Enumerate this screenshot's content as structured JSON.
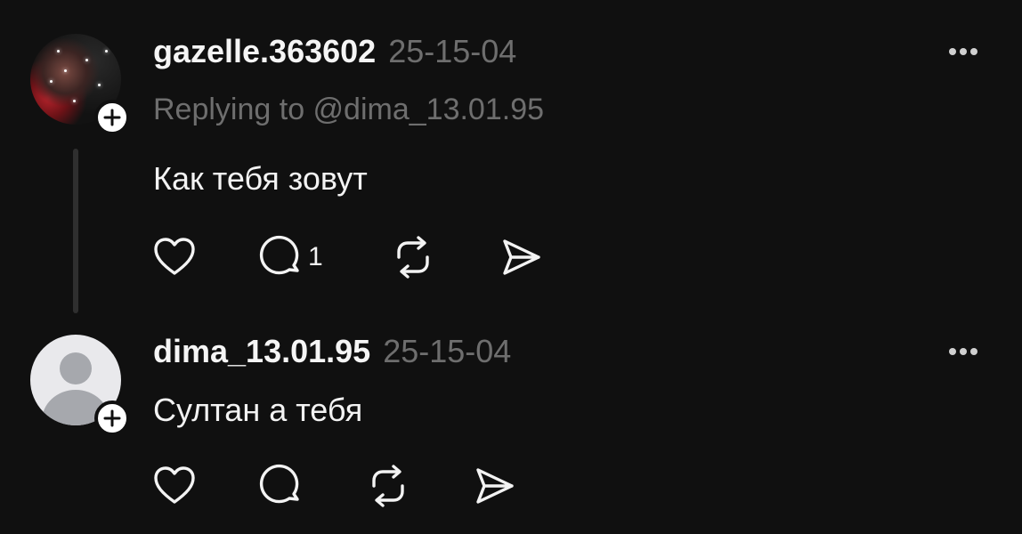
{
  "posts": [
    {
      "username": "gazelle.363602",
      "timestamp": "25-15-04",
      "reply_to": "Replying to @dima_13.01.95",
      "text": "Как тебя зовут",
      "reply_count": "1",
      "avatar_icon": "user-photo",
      "follow_icon": "plus-icon"
    },
    {
      "username": "dima_13.01.95",
      "timestamp": "25-15-04",
      "text": "Султан а тебя",
      "avatar_icon": "default-user-icon",
      "follow_icon": "plus-icon"
    }
  ],
  "icons": {
    "like": "heart-icon",
    "reply": "comment-icon",
    "repost": "repost-icon",
    "share": "send-icon",
    "more": "more-icon"
  },
  "colors": {
    "background": "#101010",
    "text": "#f3f3f3",
    "muted": "#6e6e6e",
    "thread_line": "#2f2f2f"
  }
}
